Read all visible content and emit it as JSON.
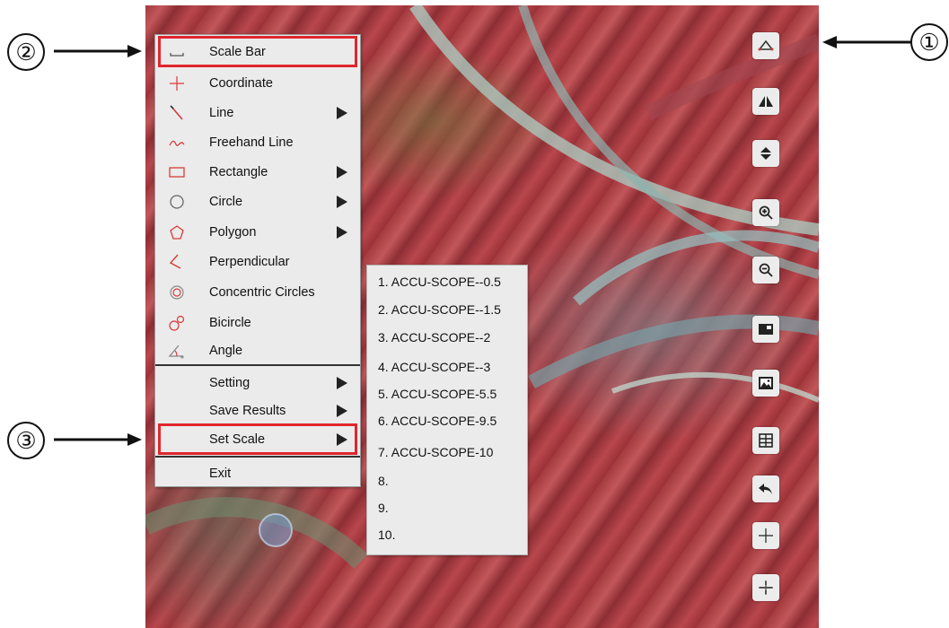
{
  "menu": {
    "items": [
      {
        "label": "Scale Bar",
        "icon": "scale-bar-icon",
        "submenu": false
      },
      {
        "label": "Coordinate",
        "icon": "coordinate-icon",
        "submenu": false
      },
      {
        "label": "Line",
        "icon": "line-icon",
        "submenu": true
      },
      {
        "label": "Freehand Line",
        "icon": "freehand-line-icon",
        "submenu": false
      },
      {
        "label": "Rectangle",
        "icon": "rectangle-icon",
        "submenu": true
      },
      {
        "label": "Circle",
        "icon": "circle-icon",
        "submenu": true
      },
      {
        "label": "Polygon",
        "icon": "polygon-icon",
        "submenu": true
      },
      {
        "label": "Perpendicular",
        "icon": "perpendicular-icon",
        "submenu": false
      },
      {
        "label": "Concentric Circles",
        "icon": "concentric-circles-icon",
        "submenu": false
      },
      {
        "label": "Bicircle",
        "icon": "bicircle-icon",
        "submenu": false
      },
      {
        "label": "Angle",
        "icon": "angle-icon",
        "submenu": false
      },
      {
        "label": "Setting",
        "submenu": true
      },
      {
        "label": "Save Results",
        "submenu": true
      },
      {
        "label": "Set Scale",
        "submenu": true
      },
      {
        "label": "Exit",
        "submenu": false
      }
    ]
  },
  "submenu": {
    "items": [
      "1. ACCU-SCOPE--0.5",
      "2. ACCU-SCOPE--1.5",
      "3. ACCU-SCOPE--2",
      "4. ACCU-SCOPE--3",
      "5. ACCU-SCOPE-5.5",
      "6. ACCU-SCOPE-9.5",
      "7. ACCU-SCOPE-10",
      "8.",
      "9.",
      "10."
    ]
  },
  "toolbar": {
    "buttons": [
      "measure-icon",
      "flip-horizontal-icon",
      "flip-vertical-icon",
      "zoom-in-icon",
      "zoom-out-icon",
      "picture-in-picture-icon",
      "image-icon",
      "grid-icon",
      "undo-icon",
      "crosshair-icon",
      "crosshair-scale-icon"
    ]
  },
  "annotations": {
    "one": "①",
    "two": "②",
    "three": "③"
  },
  "colors": {
    "highlight": "#e0262d",
    "icon_red": "#d93a3a",
    "menu_bg": "#ebebeb"
  }
}
